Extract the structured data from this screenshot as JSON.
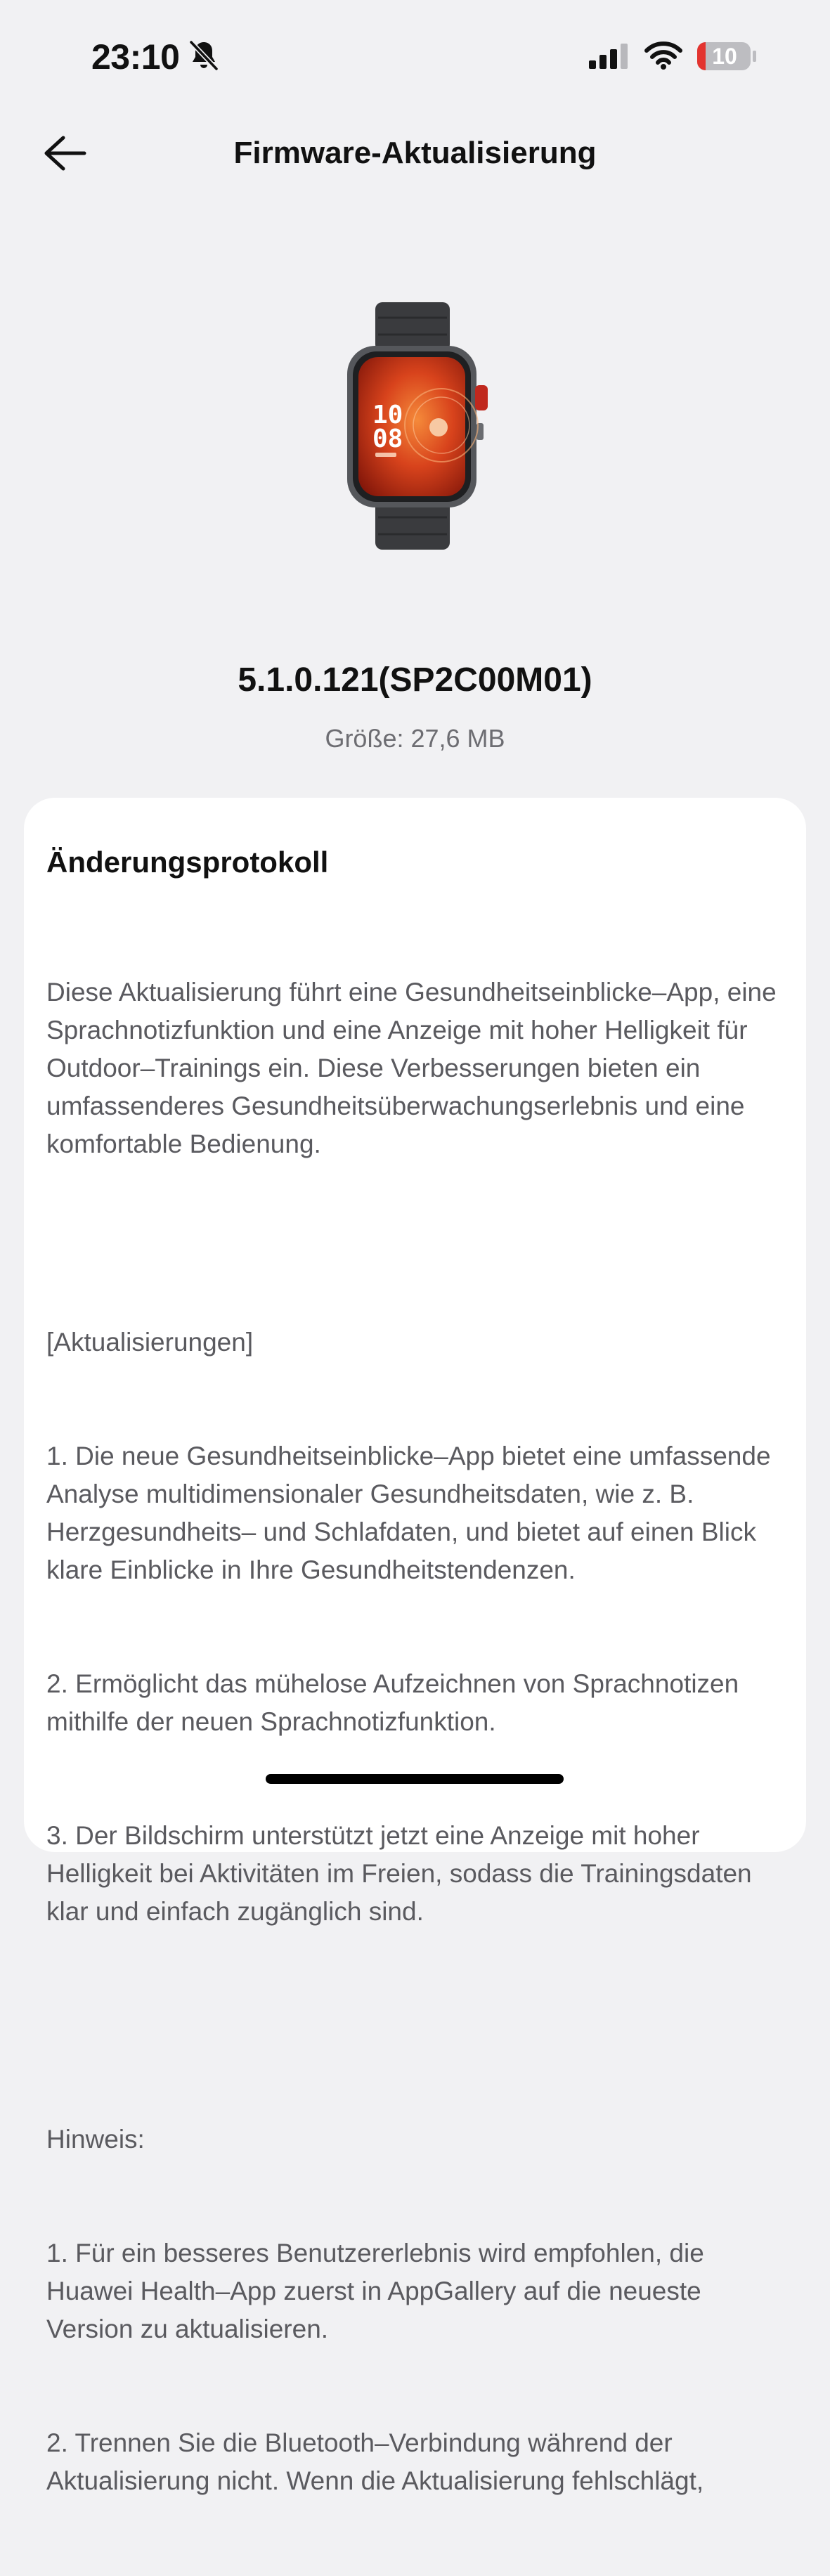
{
  "status": {
    "time": "23:10",
    "battery": "10",
    "icons": [
      "bell-slash-icon",
      "cellular-signal-icon",
      "wifi-icon",
      "battery-low-icon"
    ]
  },
  "header": {
    "title": "Firmware-Aktualisierung",
    "back_icon": "arrow-left-icon"
  },
  "device": {
    "image": "smartwatch-image",
    "version": "5.1.0.121(SP2C00M01)",
    "size": "Größe: 27,6 MB"
  },
  "changelog": {
    "title": "Änderungsprotokoll",
    "intro": "Diese Aktualisierung führt eine Gesundheitseinblicke–App, eine Sprachnotizfunktion und eine Anzeige mit hoher Helligkeit für Outdoor–Trainings ein. Diese Verbesserungen bieten ein umfassenderes Gesundheitsüberwachungserlebnis und eine komfortable Bedienung.",
    "updates_heading": "[Aktualisierungen]",
    "updates": [
      "1. Die neue Gesundheitseinblicke–App bietet eine umfassende Analyse multidimensionaler Gesundheitsdaten, wie z. B. Herzgesundheits– und Schlafdaten, und bietet auf einen Blick klare Einblicke in Ihre Gesundheitstendenzen.",
      "2. Ermöglicht das mühelose Aufzeichnen von Sprachnotizen mithilfe der neuen Sprachnotizfunktion.",
      "3. Der Bildschirm unterstützt jetzt eine Anzeige mit hoher Helligkeit bei Aktivitäten im Freien, sodass die Trainingsdaten klar und einfach zugänglich sind."
    ],
    "notes_heading": "Hinweis:",
    "notes": [
      "1. Für ein besseres Benutzererlebnis wird empfohlen, die Huawei Health–App zuerst in AppGallery auf die neueste Version zu aktualisieren.",
      "2. Trennen Sie die Bluetooth–Verbindung während der Aktualisierung nicht. Wenn die Aktualisierung fehlschlägt,"
    ]
  }
}
